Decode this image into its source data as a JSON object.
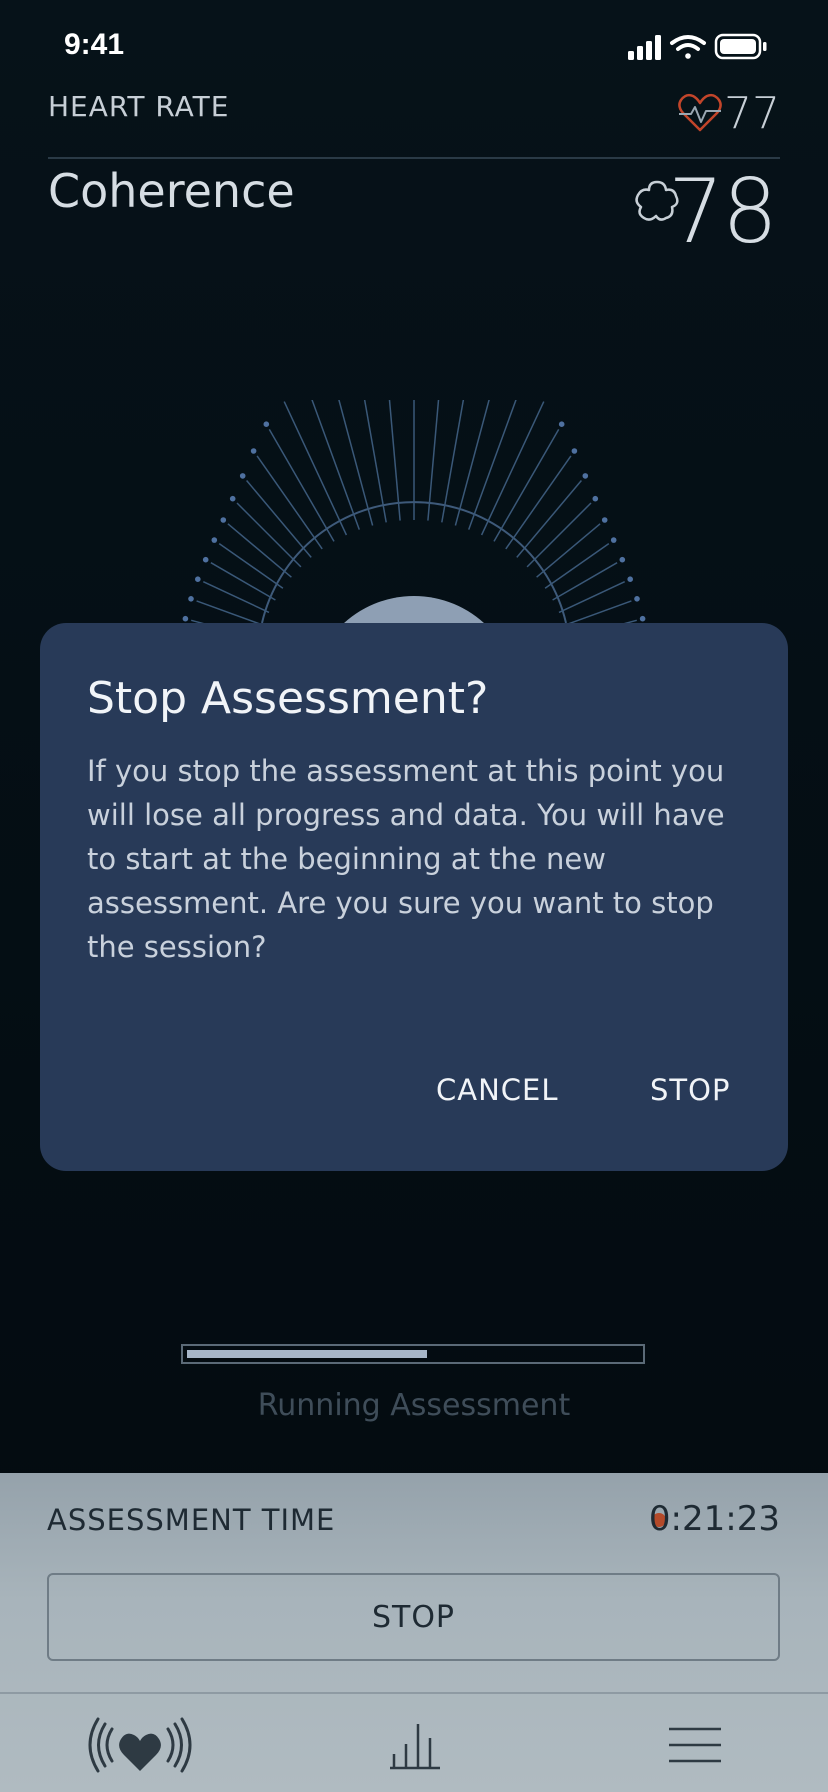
{
  "status_bar": {
    "time": "9:41"
  },
  "header": {
    "heart_rate_label": "HEART RATE",
    "heart_rate_value": "77",
    "coherence_label": "Coherence",
    "coherence_value": "78"
  },
  "assessment": {
    "progress": 0.53,
    "status_text": "Running Assessment"
  },
  "dialog": {
    "title": "Stop Assessment?",
    "body": "If you stop the assessment at this point you will lose all progress and data. You will have to start at the beginning at the new assessment. Are you sure you want to stop the session?",
    "cancel_label": "CANCEL",
    "stop_label": "STOP"
  },
  "bottom_panel": {
    "time_label": "ASSESSMENT TIME",
    "time_value": "0:21:23",
    "stop_label": "STOP"
  },
  "tab_bar": {
    "items": [
      {
        "icon": "heart-signal-icon"
      },
      {
        "icon": "bar-chart-icon"
      },
      {
        "icon": "menu-icon"
      }
    ]
  },
  "colors": {
    "background": "#040b10",
    "dialog": "#283a58",
    "accent_heart": "#c2452a",
    "recording_dot": "#b34a2a",
    "bottom_panel": "#a8b4bb"
  }
}
